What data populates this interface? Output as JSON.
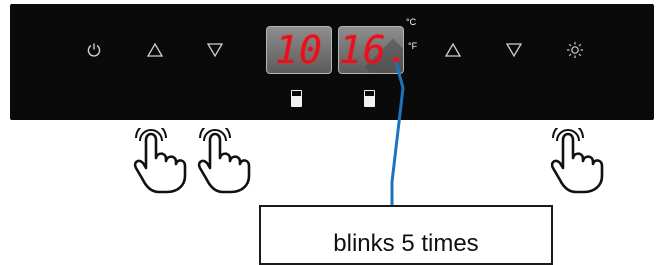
{
  "panel": {
    "buttons": [
      {
        "icon": "power-icon"
      },
      {
        "icon": "triangle-up-icon"
      },
      {
        "icon": "triangle-down-icon"
      },
      {
        "icon": "triangle-up-icon"
      },
      {
        "icon": "triangle-down-icon"
      },
      {
        "icon": "light-icon"
      }
    ],
    "left_display": {
      "value": "10"
    },
    "right_display": {
      "value": "16."
    },
    "unit_c": "°C",
    "unit_f": "°F"
  },
  "callout": {
    "text": "blinks 5 times"
  },
  "colors": {
    "panel": "#0a0a0a",
    "led": "#e8101a",
    "leader_line": "#1e73be"
  }
}
